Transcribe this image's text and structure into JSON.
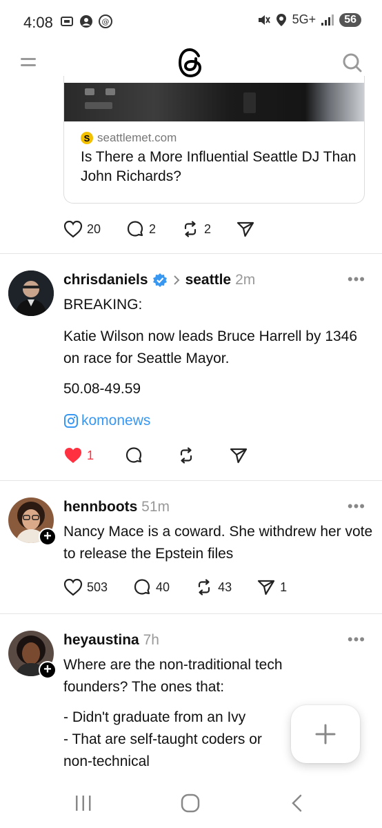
{
  "status": {
    "time": "4:08",
    "network": "5G+",
    "battery": "56"
  },
  "top_bar": {
    "menu_icon": "menu-icon",
    "logo_icon": "threads-logo-icon",
    "search_icon": "search-icon"
  },
  "link_card": {
    "domain": "seattlemet.com",
    "favicon_letter": "S",
    "title": "Is There a More Influential Seattle DJ Than John Richards?"
  },
  "prev_post_actions": {
    "likes": "20",
    "replies": "2",
    "reposts": "2"
  },
  "posts": [
    {
      "username": "chrisdaniels",
      "verified": true,
      "community": "seattle",
      "time": "2m",
      "paragraphs": [
        "BREAKING:",
        "Katie Wilson now leads Bruce Harrell by 1346 on race for Seattle Mayor.",
        "50.08-49.59"
      ],
      "link_handle": "komonews",
      "likes": "1",
      "liked": true
    },
    {
      "username": "hennboots",
      "time": "51m",
      "text": "Nancy Mace is a coward. She withdrew her vote to release the Epstein files",
      "likes": "503",
      "replies": "40",
      "reposts": "43",
      "shares": "1"
    },
    {
      "username": "heyaustina",
      "time": "7h",
      "text": "Where are the non-traditional tech founders? The ones that:",
      "list": [
        "- Didn't graduate from an Ivy",
        "- That are self-taught coders or non-technical"
      ]
    }
  ],
  "colors": {
    "accent_blue": "#3897f0",
    "like_red": "#ff3040",
    "divider": "#e4e4e4"
  }
}
